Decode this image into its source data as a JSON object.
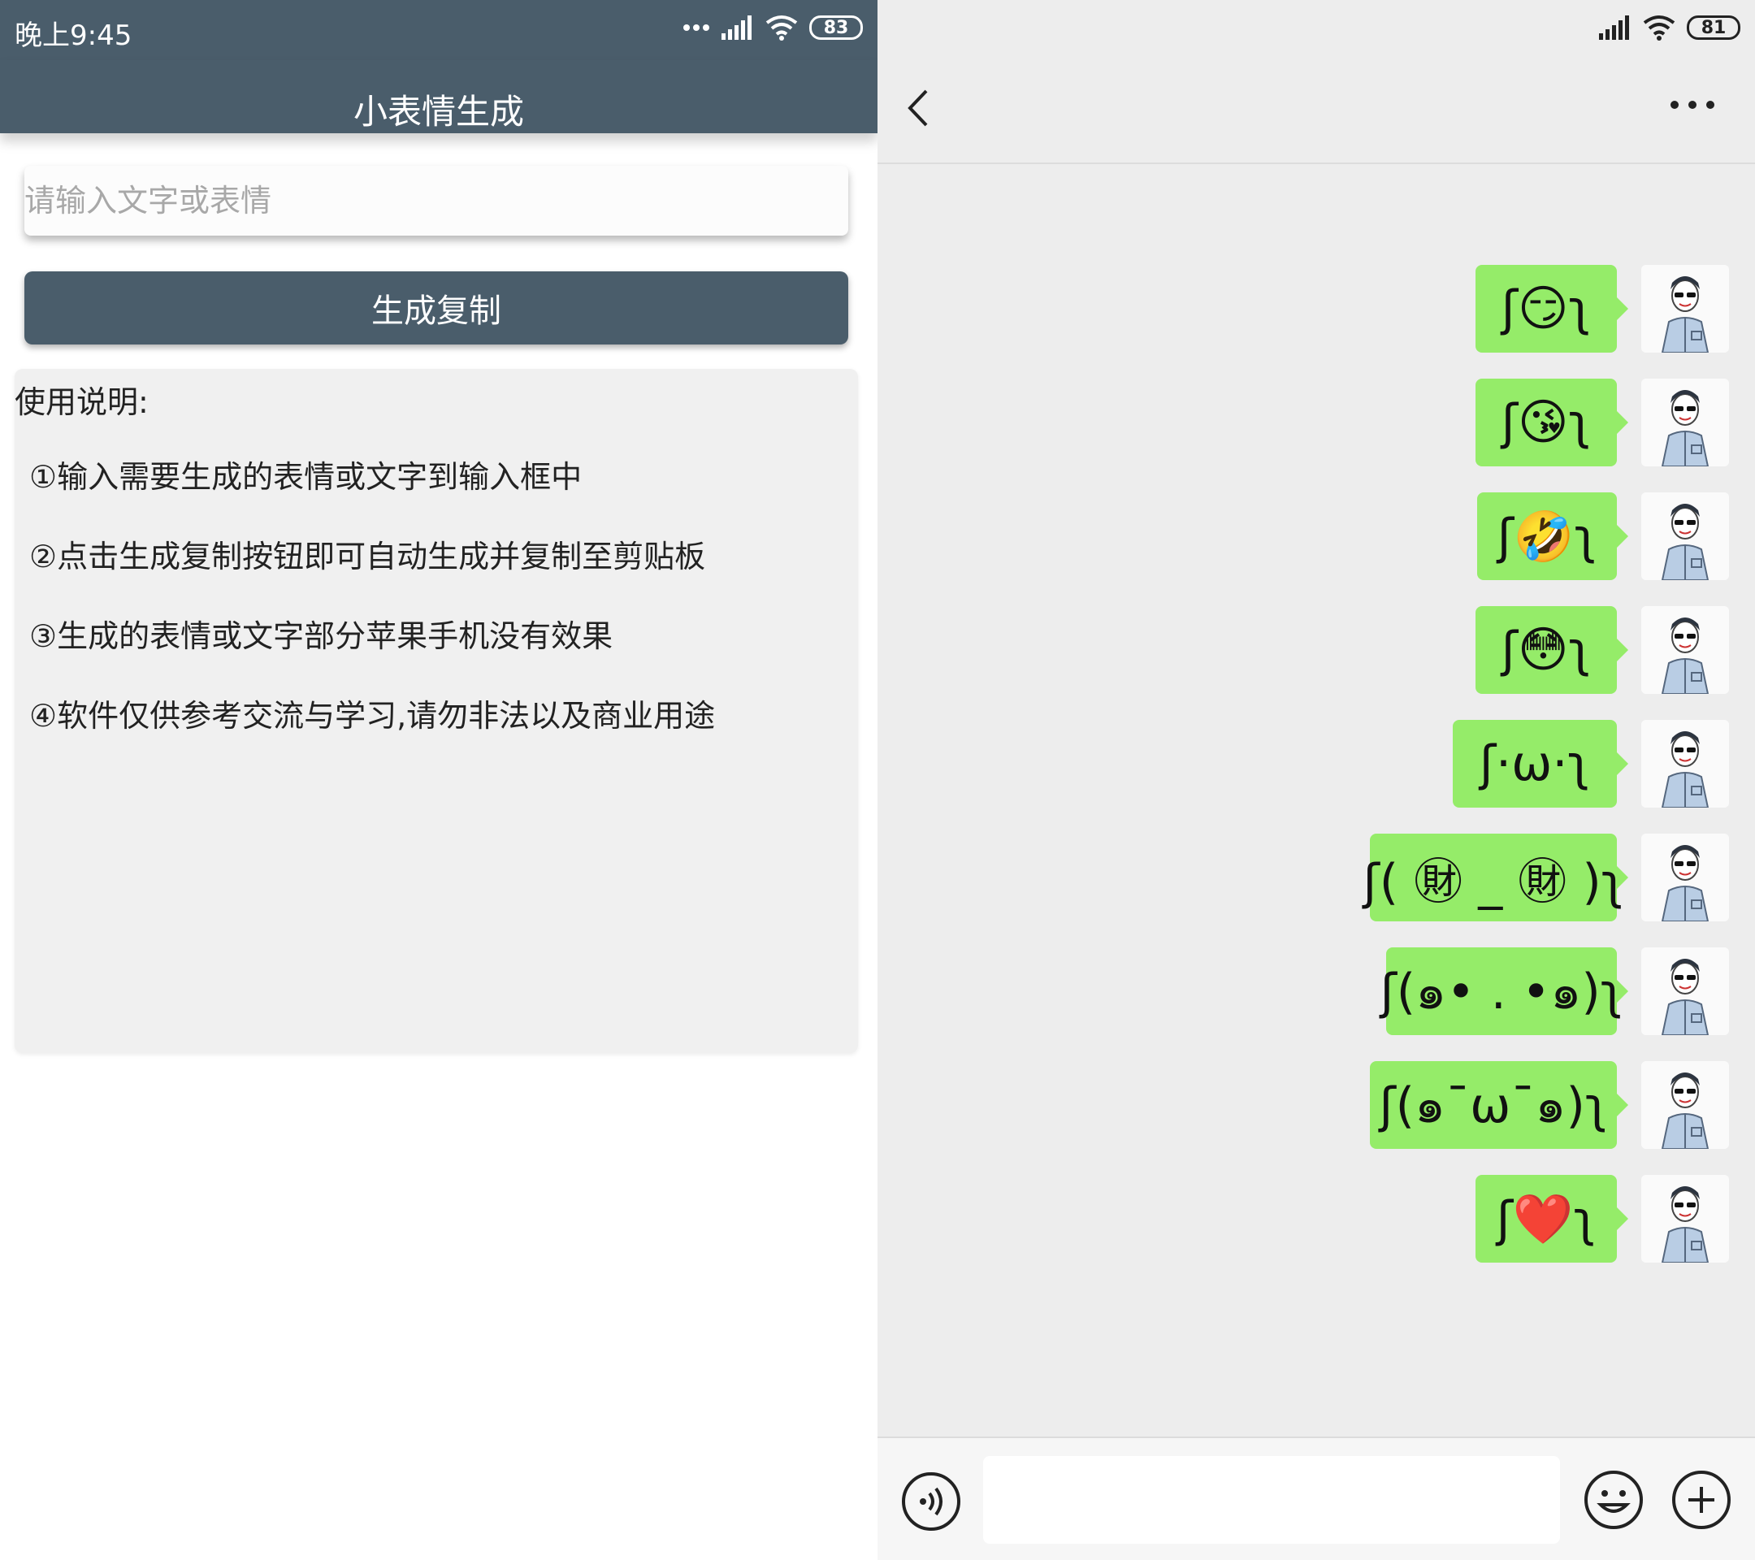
{
  "left": {
    "status": {
      "time": "晚上9:45",
      "battery": "83"
    },
    "title": "小表情生成",
    "input": {
      "placeholder": "请输入文字或表情",
      "value": ""
    },
    "button_label": "生成复制",
    "instructions": {
      "title": "使用说明:",
      "steps": [
        "①输入需要生成的表情或文字到输入框中",
        "②点击生成复制按钮即可自动生成并复制至剪贴板",
        "③生成的表情或文字部分苹果手机没有效果",
        "④软件仅供参考交流与学习,请勿非法以及商业用途"
      ]
    }
  },
  "right": {
    "status": {
      "battery": "81"
    },
    "messages": [
      "ʃ😏ʅ",
      "ʃ😘ʅ",
      "ʃ🤣ʅ",
      "ʃ😳ʅ",
      "ʃ·ω·ʅ",
      "ʃ( ㊖ _ ㊖ )ʅ",
      "ʃ(๑• . •๑)ʅ",
      "ʃ(๑ˉωˉ๑)ʅ",
      "ʃ❤️ʅ"
    ],
    "input_value": ""
  },
  "colors": {
    "app_bar": "#4a5d6b",
    "bubble": "#95ec69",
    "chat_bg": "#ededed"
  }
}
